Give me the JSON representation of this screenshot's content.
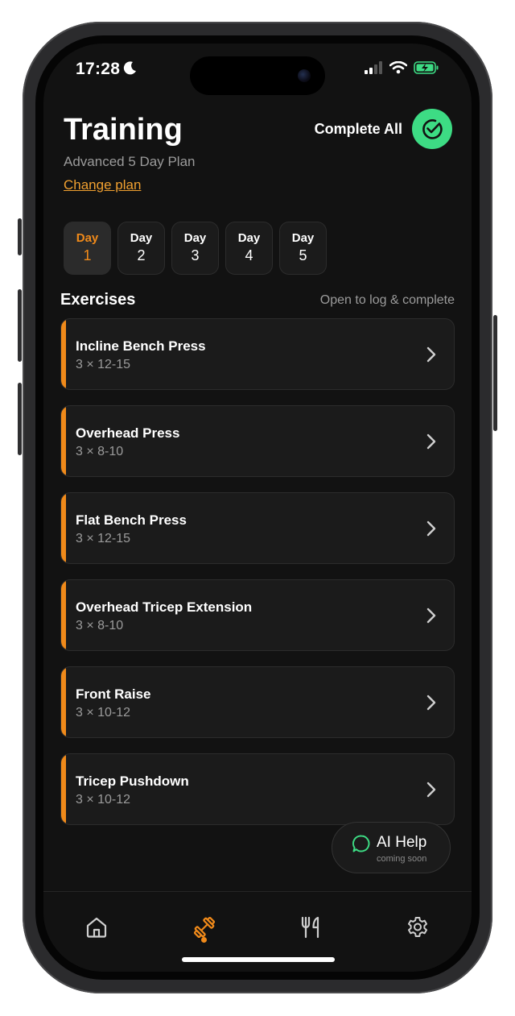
{
  "status": {
    "time": "17:28"
  },
  "header": {
    "title": "Training",
    "subtitle": "Advanced 5 Day Plan",
    "change_plan": "Change plan",
    "complete_all": "Complete All"
  },
  "days": [
    {
      "label": "Day",
      "num": "1",
      "active": true
    },
    {
      "label": "Day",
      "num": "2",
      "active": false
    },
    {
      "label": "Day",
      "num": "3",
      "active": false
    },
    {
      "label": "Day",
      "num": "4",
      "active": false
    },
    {
      "label": "Day",
      "num": "5",
      "active": false
    }
  ],
  "exercises_header": "Exercises",
  "exercises_hint": "Open to log & complete",
  "exercises": [
    {
      "name": "Incline Bench Press",
      "sets": "3 × 12-15"
    },
    {
      "name": "Overhead Press",
      "sets": "3 × 8-10"
    },
    {
      "name": "Flat Bench Press",
      "sets": "3 × 12-15"
    },
    {
      "name": "Overhead Tricep Extension",
      "sets": "3 × 8-10"
    },
    {
      "name": "Front Raise",
      "sets": "3 × 10-12"
    },
    {
      "name": "Tricep Pushdown",
      "sets": "3 × 10-12"
    }
  ],
  "ai_help": {
    "label": "AI Help",
    "sub": "coming soon"
  },
  "tabs": [
    {
      "icon": "home-icon"
    },
    {
      "icon": "dumbbell-icon",
      "active": true
    },
    {
      "icon": "fork-knife-icon"
    },
    {
      "icon": "gear-icon"
    }
  ],
  "colors": {
    "accent": "#f08a1a",
    "success": "#3ddc84",
    "link": "#f0a030",
    "background": "#121212"
  }
}
